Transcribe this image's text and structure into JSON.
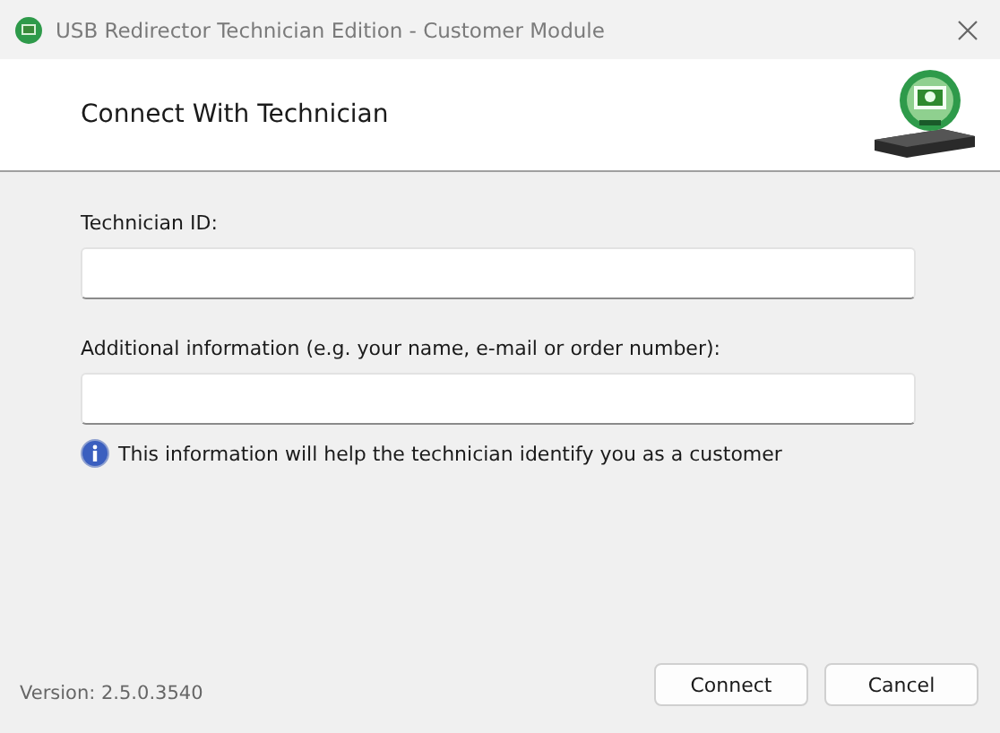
{
  "window": {
    "title": "USB Redirector Technician Edition - Customer Module"
  },
  "header": {
    "title": "Connect With Technician"
  },
  "fields": [
    {
      "label": "Technician ID:"
    },
    {
      "label": "Additional information (e.g. your name, e-mail or order number):"
    }
  ],
  "info": "This information will help the technician identify you as a customer",
  "version": "Version: 2.5.0.3540",
  "buttons": [
    "Connect",
    "Cancel"
  ]
}
